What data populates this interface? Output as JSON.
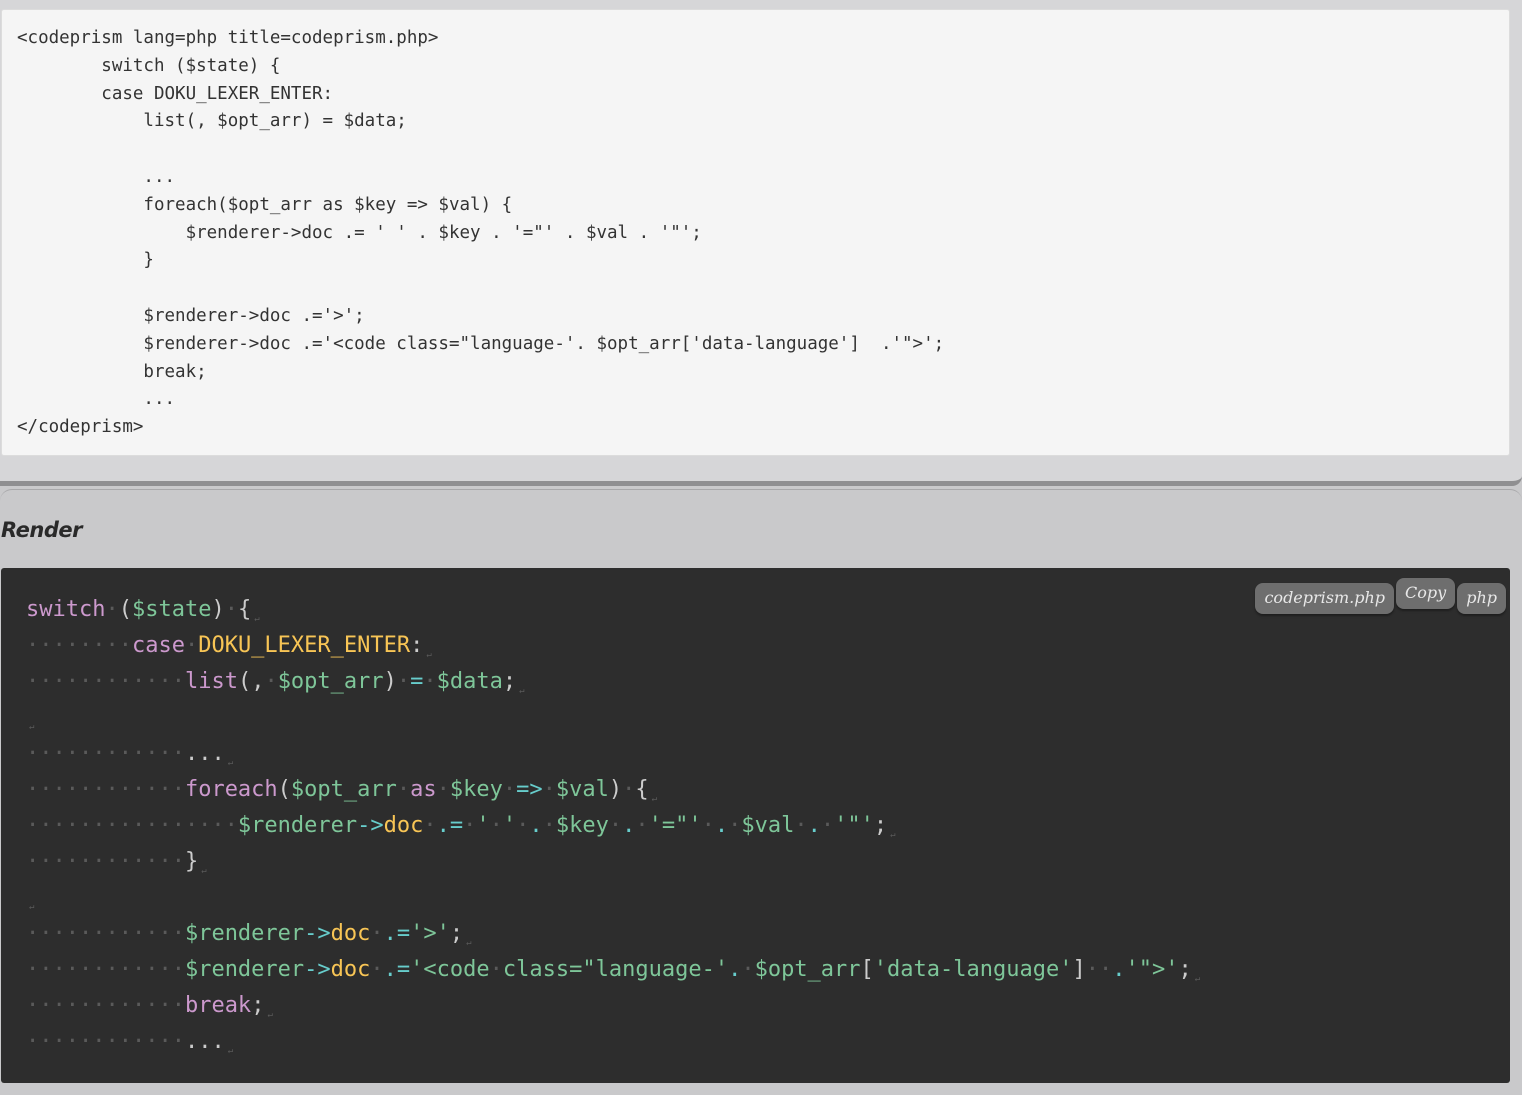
{
  "source": {
    "lines": [
      "<codeprism lang=php title=codeprism.php>",
      "        switch ($state) {",
      "        case DOKU_LEXER_ENTER:",
      "            list(, $opt_arr) = $data;",
      "",
      "            ...",
      "            foreach($opt_arr as $key => $val) {",
      "                $renderer->doc .= ' ' . $key . '=\"' . $val . '\"';",
      "            }",
      "",
      "            $renderer->doc .='>';",
      "            $renderer->doc .='<code class=\"language-'. $opt_arr['data-language']  .'\">';",
      "            break;",
      "            ...",
      "</codeprism>"
    ]
  },
  "render": {
    "heading": "Render",
    "toolbar": {
      "filename": "codeprism.php",
      "copy_label": "Copy",
      "language": "php"
    }
  },
  "highlighted_code": [
    [
      [
        "kw",
        "switch"
      ],
      [
        "ws",
        "·"
      ],
      [
        "pun",
        "("
      ],
      [
        "var",
        "$state"
      ],
      [
        "pun",
        ")"
      ],
      [
        "ws",
        "·"
      ],
      [
        "pun",
        "{"
      ]
    ],
    [
      [
        "ws",
        "········"
      ],
      [
        "kw",
        "case"
      ],
      [
        "ws",
        "·"
      ],
      [
        "const",
        "DOKU_LEXER_ENTER"
      ],
      [
        "pun",
        ":"
      ]
    ],
    [
      [
        "ws",
        "············"
      ],
      [
        "kw",
        "list"
      ],
      [
        "pun",
        "("
      ],
      [
        "pun",
        ","
      ],
      [
        "ws",
        "·"
      ],
      [
        "var",
        "$opt_arr"
      ],
      [
        "pun",
        ")"
      ],
      [
        "ws",
        "·"
      ],
      [
        "op",
        "="
      ],
      [
        "ws",
        "·"
      ],
      [
        "var",
        "$data"
      ],
      [
        "pun",
        ";"
      ]
    ],
    [],
    [
      [
        "ws",
        "············"
      ],
      [
        "pun",
        "..."
      ]
    ],
    [
      [
        "ws",
        "············"
      ],
      [
        "kw",
        "foreach"
      ],
      [
        "pun",
        "("
      ],
      [
        "var",
        "$opt_arr"
      ],
      [
        "ws",
        "·"
      ],
      [
        "kw",
        "as"
      ],
      [
        "ws",
        "·"
      ],
      [
        "var",
        "$key"
      ],
      [
        "ws",
        "·"
      ],
      [
        "op",
        "=>"
      ],
      [
        "ws",
        "·"
      ],
      [
        "var",
        "$val"
      ],
      [
        "pun",
        ")"
      ],
      [
        "ws",
        "·"
      ],
      [
        "pun",
        "{"
      ]
    ],
    [
      [
        "ws",
        "················"
      ],
      [
        "var",
        "$renderer"
      ],
      [
        "op",
        "->"
      ],
      [
        "const",
        "doc"
      ],
      [
        "ws",
        "·"
      ],
      [
        "op",
        ".="
      ],
      [
        "ws",
        "·"
      ],
      [
        "str",
        "'"
      ],
      [
        "ws",
        "·"
      ],
      [
        "str",
        "'"
      ],
      [
        "ws",
        "·"
      ],
      [
        "op",
        "."
      ],
      [
        "ws",
        "·"
      ],
      [
        "var",
        "$key"
      ],
      [
        "ws",
        "·"
      ],
      [
        "op",
        "."
      ],
      [
        "ws",
        "·"
      ],
      [
        "str",
        "'=\"'"
      ],
      [
        "ws",
        "·"
      ],
      [
        "op",
        "."
      ],
      [
        "ws",
        "·"
      ],
      [
        "var",
        "$val"
      ],
      [
        "ws",
        "·"
      ],
      [
        "op",
        "."
      ],
      [
        "ws",
        "·"
      ],
      [
        "str",
        "'\"'"
      ],
      [
        "pun",
        ";"
      ]
    ],
    [
      [
        "ws",
        "············"
      ],
      [
        "pun",
        "}"
      ]
    ],
    [],
    [
      [
        "ws",
        "············"
      ],
      [
        "var",
        "$renderer"
      ],
      [
        "op",
        "->"
      ],
      [
        "const",
        "doc"
      ],
      [
        "ws",
        "·"
      ],
      [
        "op",
        ".="
      ],
      [
        "str",
        "'>'"
      ],
      [
        "pun",
        ";"
      ]
    ],
    [
      [
        "ws",
        "············"
      ],
      [
        "var",
        "$renderer"
      ],
      [
        "op",
        "->"
      ],
      [
        "const",
        "doc"
      ],
      [
        "ws",
        "·"
      ],
      [
        "op",
        ".="
      ],
      [
        "str",
        "'<code"
      ],
      [
        "ws",
        "·"
      ],
      [
        "str",
        "class=\"language-'"
      ],
      [
        "op",
        "."
      ],
      [
        "ws",
        "·"
      ],
      [
        "var",
        "$opt_arr"
      ],
      [
        "pun",
        "["
      ],
      [
        "str",
        "'data-language'"
      ],
      [
        "pun",
        "]"
      ],
      [
        "ws",
        "··"
      ],
      [
        "op",
        "."
      ],
      [
        "str",
        "'\">'"
      ],
      [
        "pun",
        ";"
      ]
    ],
    [
      [
        "ws",
        "············"
      ],
      [
        "kw",
        "break"
      ],
      [
        "pun",
        ";"
      ]
    ],
    [
      [
        "ws",
        "············"
      ],
      [
        "pun",
        "..."
      ]
    ]
  ],
  "colors": {
    "keyword": "#cc99cd",
    "variable": "#7ec699",
    "constant": "#f8c555",
    "operator": "#67cdcc",
    "code_background": "#2d2d2d",
    "source_background": "#f5f5f5"
  },
  "icons": {
    "eol_marker": "↵"
  }
}
